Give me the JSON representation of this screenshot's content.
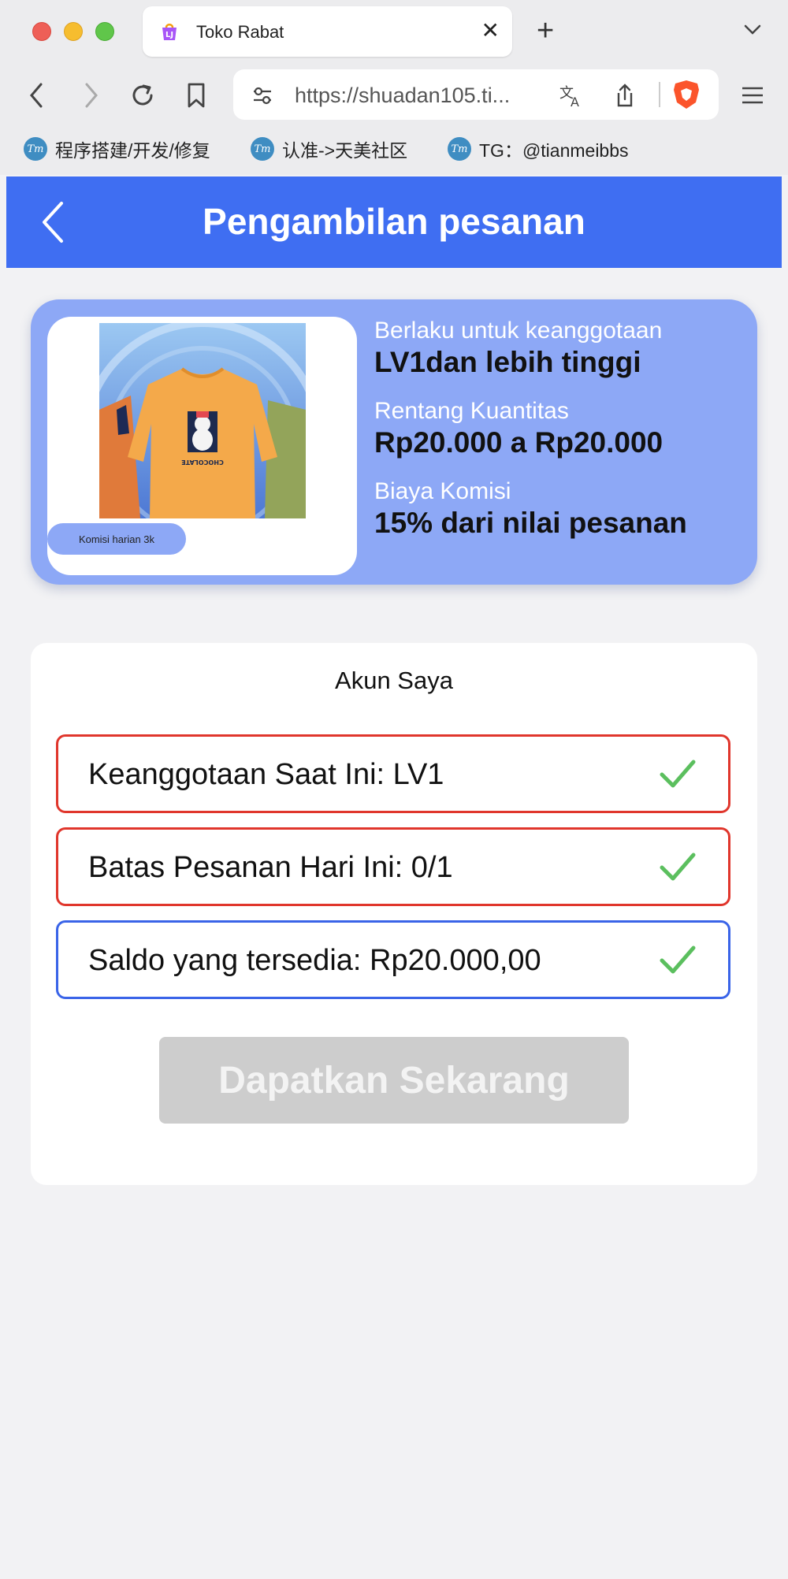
{
  "browser": {
    "tab_title": "Toko Rabat",
    "url": "https://shuadan105.ti...",
    "bookmarks": [
      {
        "label": "程序搭建/开发/修复"
      },
      {
        "label": "认准->天美社区"
      },
      {
        "label": "TG：@tianmeibbs"
      }
    ],
    "bookmark_icon_text": "Tm"
  },
  "header": {
    "title": "Pengambilan pesanan"
  },
  "product": {
    "commission_badge": "Komisi harian 3k",
    "membership_label": "Berlaku untuk keanggotaan",
    "membership_value": "LV1dan lebih tinggi",
    "quantity_label": "Rentang Kuantitas",
    "quantity_value": "Rp20.000 a Rp20.000",
    "commission_label": "Biaya Komisi",
    "commission_value": "15% dari nilai pesanan"
  },
  "account": {
    "title": "Akun Saya",
    "rows": [
      {
        "text": "Keanggotaan Saat Ini: LV1",
        "status": "ok"
      },
      {
        "text": "Batas Pesanan Hari Ini: 0/1",
        "status": "ok"
      },
      {
        "text": "Saldo yang tersedia: Rp20.000,00",
        "status": "ok"
      }
    ],
    "button_label": "Dapatkan Sekarang"
  },
  "colors": {
    "header_blue": "#3f6ef2",
    "card_blue": "#8da8f6",
    "row_red": "#e0362c",
    "row_blue": "#3a64e8",
    "check_green": "#5bbf5e",
    "button_disabled": "#cdcdcd"
  },
  "icons": [
    "back-arrow-icon",
    "forward-arrow-icon",
    "reload-icon",
    "bookmark-icon",
    "site-settings-icon",
    "translate-icon",
    "share-icon",
    "brave-shield-icon",
    "menu-icon",
    "check-icon"
  ]
}
